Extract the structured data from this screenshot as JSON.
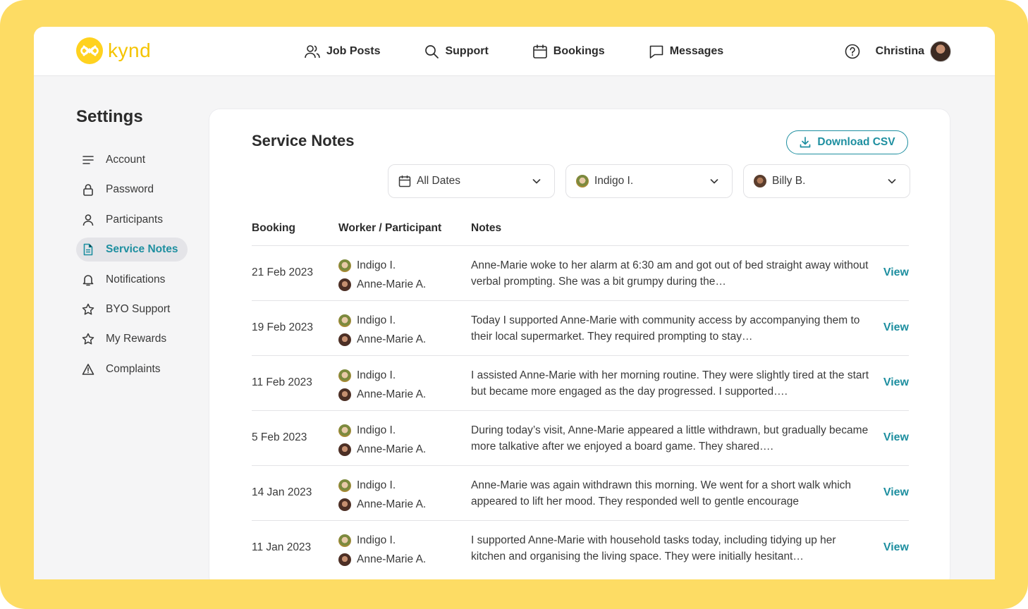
{
  "brand": {
    "name": "kynd",
    "accent": "#1E8FA0",
    "logo_color": "#FFD21F",
    "frame_color": "#FDDC64"
  },
  "nav": {
    "links": [
      {
        "label": "Job Posts",
        "icon": "users-icon"
      },
      {
        "label": "Support",
        "icon": "search-icon"
      },
      {
        "label": "Bookings",
        "icon": "calendar-icon"
      },
      {
        "label": "Messages",
        "icon": "chat-icon"
      }
    ],
    "help_icon": "help-circle-icon",
    "user_name": "Christina"
  },
  "sidebar": {
    "title": "Settings",
    "items": [
      {
        "label": "Account",
        "icon": "menu-lines-icon",
        "active": false
      },
      {
        "label": "Password",
        "icon": "lock-icon",
        "active": false
      },
      {
        "label": "Participants",
        "icon": "user-icon",
        "active": false
      },
      {
        "label": "Service Notes",
        "icon": "document-icon",
        "active": true
      },
      {
        "label": "Notifications",
        "icon": "bell-icon",
        "active": false
      },
      {
        "label": "BYO Support",
        "icon": "star-icon",
        "active": false
      },
      {
        "label": "My Rewards",
        "icon": "star-icon",
        "active": false
      },
      {
        "label": "Complaints",
        "icon": "warning-icon",
        "active": false
      }
    ]
  },
  "main": {
    "title": "Service Notes",
    "download_label": "Download CSV",
    "filters": [
      {
        "label": "All Dates",
        "icon": "calendar-icon"
      },
      {
        "label": "Indigo I.",
        "icon": "worker-avatar"
      },
      {
        "label": "Billy B.",
        "icon": "participant-avatar"
      }
    ],
    "columns": [
      "Booking",
      "Worker / Participant",
      "Notes"
    ],
    "view_label": "View",
    "rows": [
      {
        "date": "21 Feb 2023",
        "worker": "Indigo I.",
        "participant": "Anne-Marie A.",
        "note": "Anne-Marie woke to her alarm at 6:30 am and got out of bed straight away without verbal prompting. She was a bit grumpy during the…"
      },
      {
        "date": "19 Feb 2023",
        "worker": "Indigo I.",
        "participant": "Anne-Marie A.",
        "note": "Today I supported Anne-Marie with community access by accompanying them to their local supermarket. They required prompting to stay…"
      },
      {
        "date": "11 Feb 2023",
        "worker": "Indigo I.",
        "participant": "Anne-Marie A.",
        "note": "I assisted Anne-Marie with her morning routine. They were slightly tired at the start but became more engaged as the day progressed. I supported…."
      },
      {
        "date": "5 Feb 2023",
        "worker": "Indigo I.",
        "participant": "Anne-Marie A.",
        "note": "During today’s visit, Anne-Marie appeared a little withdrawn, but gradually became more talkative after we enjoyed a board game. They shared…."
      },
      {
        "date": "14 Jan 2023",
        "worker": "Indigo I.",
        "participant": "Anne-Marie A.",
        "note": "Anne-Marie was again withdrawn this morning. We went for a short walk which appeared to lift her mood. They responded well to gentle encourage"
      },
      {
        "date": "11 Jan 2023",
        "worker": "Indigo I.",
        "participant": "Anne-Marie A.",
        "note": "I supported Anne-Marie with household tasks today, including tidying up her kitchen and organising the living space. They were initially hesitant…"
      }
    ]
  }
}
